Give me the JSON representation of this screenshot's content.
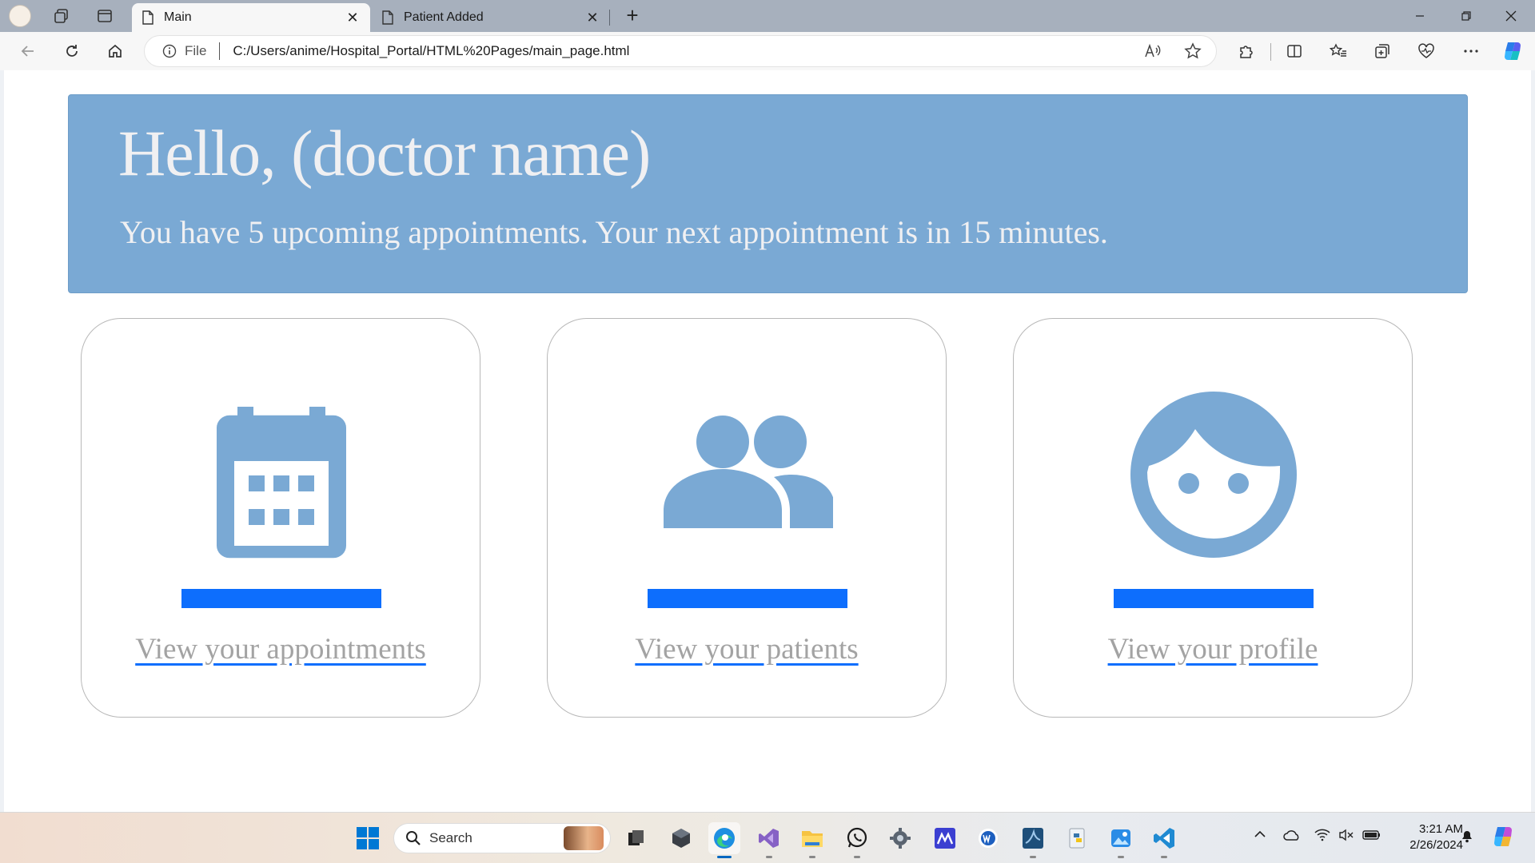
{
  "browser": {
    "tabs": [
      {
        "title": "Main",
        "active": true
      },
      {
        "title": "Patient Added",
        "active": false
      }
    ],
    "address": {
      "scheme_label": "File",
      "url": "C:/Users/anime/Hospital_Portal/HTML%20Pages/main_page.html"
    }
  },
  "page": {
    "greeting": "Hello, (doctor name)",
    "summary": "You have 5 upcoming appointments. Your next appointment is in 15 minutes.",
    "cards": [
      {
        "icon": "calendar-icon",
        "link": "View your appointments"
      },
      {
        "icon": "people-icon",
        "link": "View your patients"
      },
      {
        "icon": "face-icon",
        "link": "View your profile"
      }
    ]
  },
  "taskbar": {
    "search_label": "Search",
    "time": "3:21 AM",
    "date": "2/26/2024"
  },
  "colors": {
    "hero_bg": "#7aa9d4",
    "icon": "#7aa9d4",
    "accent": "#0d6efd",
    "link_text": "#a3a3a3"
  }
}
